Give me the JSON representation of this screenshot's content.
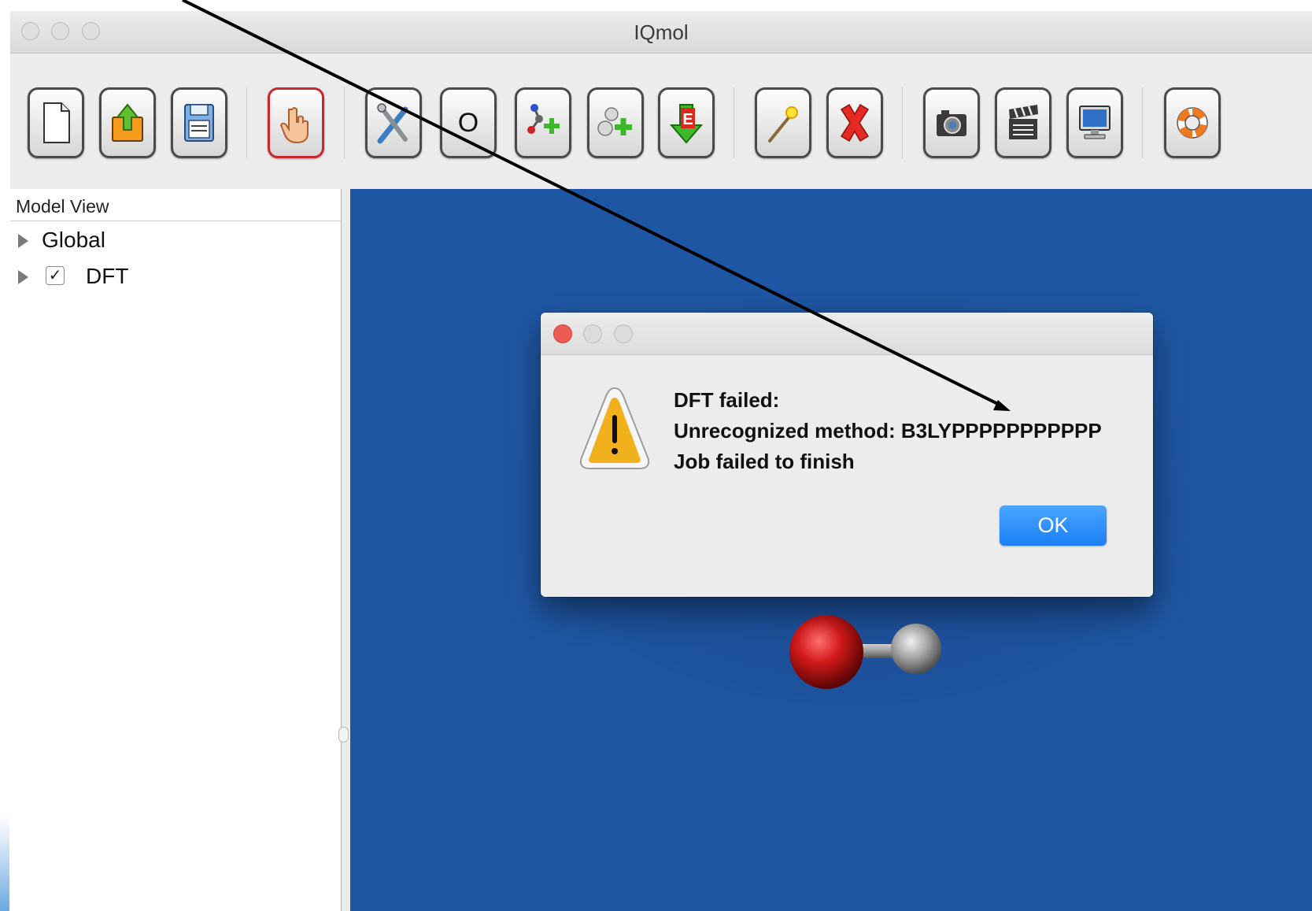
{
  "window": {
    "title": "IQmol"
  },
  "toolbar": {
    "buttons": [
      {
        "name": "new-file-button",
        "icon": "new-file-icon"
      },
      {
        "name": "open-file-button",
        "icon": "open-file-icon"
      },
      {
        "name": "save-file-button",
        "icon": "save-file-icon"
      },
      {
        "name": "select-button",
        "icon": "hand-pointer-icon",
        "active": true
      },
      {
        "name": "build-tools-button",
        "icon": "tools-icon"
      },
      {
        "name": "element-button",
        "icon": "element-icon",
        "label": "O"
      },
      {
        "name": "add-hydrogens-button",
        "icon": "add-hydrogens-icon"
      },
      {
        "name": "add-fragment-button",
        "icon": "add-fragment-icon"
      },
      {
        "name": "minimize-energy-button",
        "icon": "minimize-energy-icon",
        "label": "E"
      },
      {
        "name": "symmetrize-button",
        "icon": "magic-wand-icon"
      },
      {
        "name": "delete-button",
        "icon": "red-x-icon"
      },
      {
        "name": "screenshot-button",
        "icon": "camera-icon"
      },
      {
        "name": "record-animation-button",
        "icon": "clapperboard-icon"
      },
      {
        "name": "full-screen-button",
        "icon": "monitor-icon"
      },
      {
        "name": "help-button",
        "icon": "lifebuoy-icon"
      }
    ]
  },
  "model_view": {
    "header": "Model View",
    "items": [
      {
        "label": "Global",
        "has_checkbox": false
      },
      {
        "label": "DFT",
        "has_checkbox": true,
        "checked": true,
        "check_mark": "✓"
      }
    ]
  },
  "viewer": {
    "background": "#1f56a3",
    "molecule": "O-H fragment (red oxygen, grey hydrogen)"
  },
  "dialog": {
    "lines": [
      "DFT failed:",
      "Unrecognized method: B3LYPPPPPPPPPPP",
      "Job failed to finish"
    ],
    "ok_label": "OK",
    "icon": "warning-triangle-icon"
  },
  "colors": {
    "close": "#ee5b55",
    "ok": "#1a7ff5",
    "viewer_bg": "#1f56a3",
    "oxygen": "#c81414",
    "hydrogen": "#a5a5a5",
    "annotation_arrow": "#000000"
  }
}
